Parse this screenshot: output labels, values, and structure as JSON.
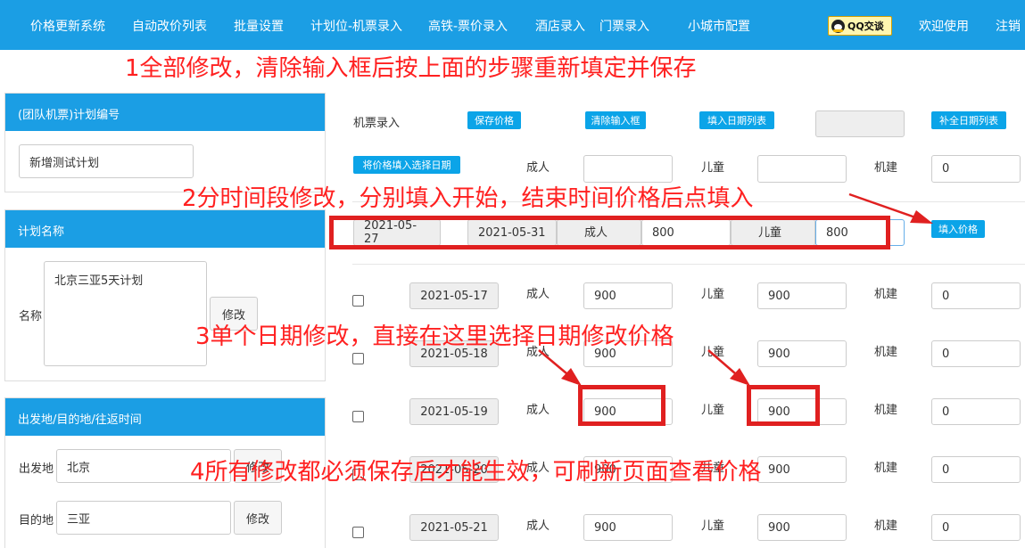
{
  "nav": {
    "items": [
      "价格更新系统",
      "自动改价列表",
      "批量设置",
      "计划位-机票录入",
      "高铁-票价录入",
      "酒店录入",
      "门票录入",
      "小城市配置"
    ],
    "qq_label": "QQ交谈",
    "welcome": "欢迎使用",
    "logout": "注销"
  },
  "annotations": {
    "a1": "1全部修改，清除输入框后按上面的步骤重新填定并保存",
    "a2": "2分时间段修改，分别填入开始，结束时间价格后点填入",
    "a3": "3单个日期修改，直接在这里选择日期修改价格",
    "a4": "4所有修改都必须保存后才能生效，可刷新页面查看价格"
  },
  "left": {
    "plan_no_title": "(团队机票)计划编号",
    "plan_no_value": "新增测试计划",
    "plan_name_title": "计划名称",
    "name_label": "名称",
    "name_value": "北京三亚5天计划",
    "modify": "修改",
    "route_title": "出发地/目的地/往返时间",
    "depart_label": "出发地",
    "depart_value": "北京",
    "dest_label": "目的地",
    "dest_value": "三亚"
  },
  "toolbar": {
    "entry_label": "机票录入",
    "save_price": "保存价格",
    "clear_inputs": "清除输入框",
    "fill_dates": "填入日期列表",
    "complete_dates": "补全日期列表",
    "fill_selected": "将价格填入选择日期",
    "adult": "成人",
    "child": "儿童",
    "fuel": "机建",
    "fuel_value": "0"
  },
  "range": {
    "start": "2021-05-27",
    "end": "2021-05-31",
    "adult_label": "成人",
    "adult_value": "800",
    "child_label": "儿童",
    "child_value": "800",
    "fill_button": "填入价格"
  },
  "rows": [
    {
      "date": "2021-05-17",
      "adult_label": "成人",
      "adult": "900",
      "child_label": "儿童",
      "child": "900",
      "fuel_label": "机建",
      "fuel": "0"
    },
    {
      "date": "2021-05-18",
      "adult_label": "成人",
      "adult": "900",
      "child_label": "儿童",
      "child": "900",
      "fuel_label": "机建",
      "fuel": "0"
    },
    {
      "date": "2021-05-19",
      "adult_label": "成人",
      "adult": "900",
      "child_label": "儿童",
      "child": "900",
      "fuel_label": "机建",
      "fuel": "0"
    },
    {
      "date": "2021-05-20",
      "adult_label": "成人",
      "adult": "900",
      "child_label": "儿童",
      "child": "900",
      "fuel_label": "机建",
      "fuel": "0"
    },
    {
      "date": "2021-05-21",
      "adult_label": "成人",
      "adult": "900",
      "child_label": "儿童",
      "child": "900",
      "fuel_label": "机建",
      "fuel": "0"
    }
  ]
}
